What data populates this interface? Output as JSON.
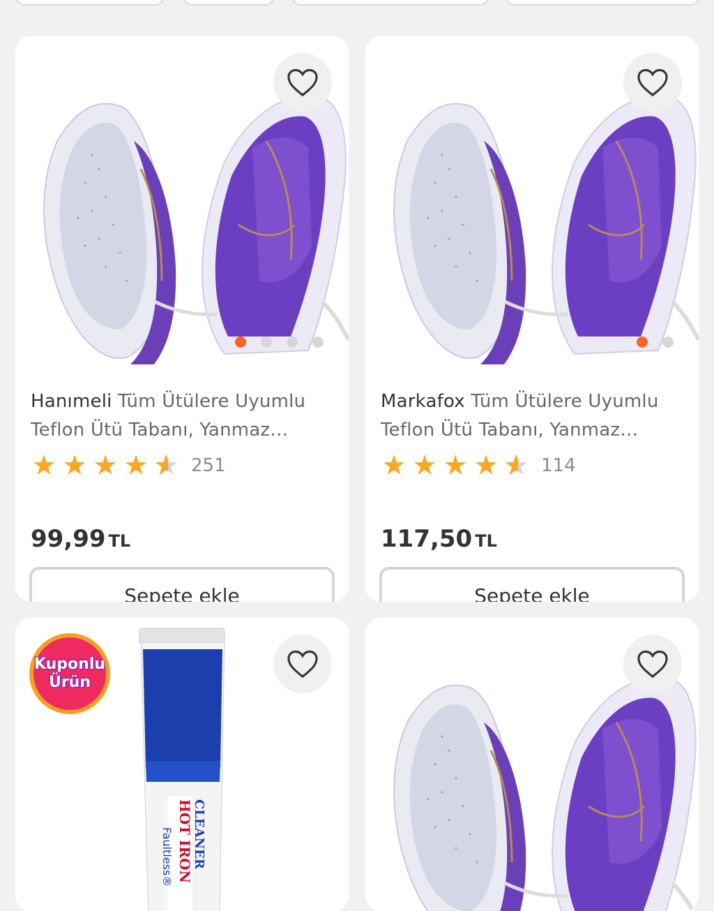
{
  "colors": {
    "accent": "#f26722",
    "star": "#f9a825",
    "badge_bg": "#ee2a61",
    "badge_ring": "#f6a021"
  },
  "products": [
    {
      "brand": "Hanımeli",
      "title": " Tüm Ütülere Uyumlu Teflon Ütü Tabanı, Yanmaz Yapışmaz",
      "rating": 4.5,
      "rating_count": "251",
      "price": "99,99",
      "currency": "TL",
      "add_to_cart": "Sepete ekle",
      "favorite_icon": "heart-icon",
      "image": "purple-iron-pair",
      "carousel_dots": 4,
      "carousel_active": 0
    },
    {
      "brand": "Markafox",
      "title": " Tüm Ütülere Uyumlu Teflon Ütü Tabanı, Yanmaz Yapışmaz",
      "rating": 4.5,
      "rating_count": "114",
      "price": "117,50",
      "currency": "TL",
      "add_to_cart": "Sepete ekle",
      "favorite_icon": "heart-icon",
      "image": "purple-iron-pair",
      "carousel_dots": 2,
      "carousel_active": 0
    },
    {
      "badge_line1": "Kuponlu",
      "badge_line2": "Ürün",
      "favorite_icon": "heart-icon",
      "image": "hot-iron-cleaner-tube"
    },
    {
      "favorite_icon": "heart-icon",
      "image": "purple-iron-pair"
    }
  ]
}
